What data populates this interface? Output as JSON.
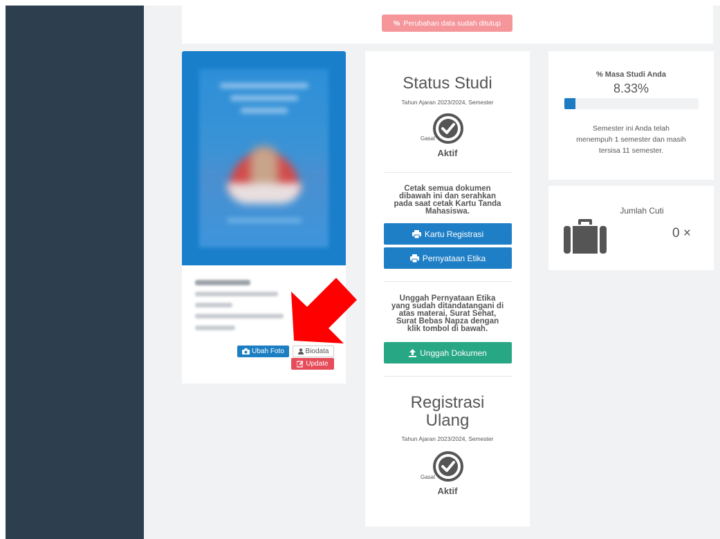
{
  "top_notice": {
    "label": "Perubahan data sudah ditutup",
    "icon": "percent-icon",
    "color": "#f5969b"
  },
  "profile": {
    "buttons": {
      "ubah_foto": "Ubah Foto",
      "biodata": "Biodata",
      "update": "Update"
    }
  },
  "status_studi": {
    "title": "Status Studi",
    "year_text": "Tahun Ajaran 2023/2024, Semester",
    "semester": "Gasal",
    "status": "Aktif"
  },
  "cetak": {
    "text": [
      "Cetak semua dokumen",
      "dibawah ini dan serahkan",
      "pada saat cetak Kartu Tanda",
      "Mahasiswa."
    ],
    "btn_kartu": "Kartu Registrasi",
    "btn_pernyataan": "Pernyataan Etika"
  },
  "unggah": {
    "text": [
      "Unggah Pernyataan Etika",
      "yang sudah ditandatangani di",
      "atas materai, Surat Sehat,",
      "Surat Bebas Napza dengan",
      "klik tombol di bawah."
    ],
    "btn": "Unggah Dokumen"
  },
  "registrasi": {
    "title_1": "Registrasi",
    "title_2": "Ulang",
    "year_text": "Tahun Ajaran 2023/2024, Semester",
    "semester": "Gasal",
    "status": "Aktif"
  },
  "masa_studi": {
    "title": "% Masa Studi Anda",
    "percent_text": "8.33%",
    "progress_fraction": 0.0833,
    "text": [
      "Semester ini Anda telah",
      "menempuh 1 semester dan masih",
      "tersisa 11 semester."
    ]
  },
  "cuti": {
    "title": "Jumlah Cuti",
    "value": "0 ×"
  },
  "colors": {
    "sidebar": "#2d3e4e",
    "primary": "#1e7fc6",
    "success": "#27a784",
    "danger": "#e64c5a",
    "annotation_arrow": "#ff0000"
  }
}
